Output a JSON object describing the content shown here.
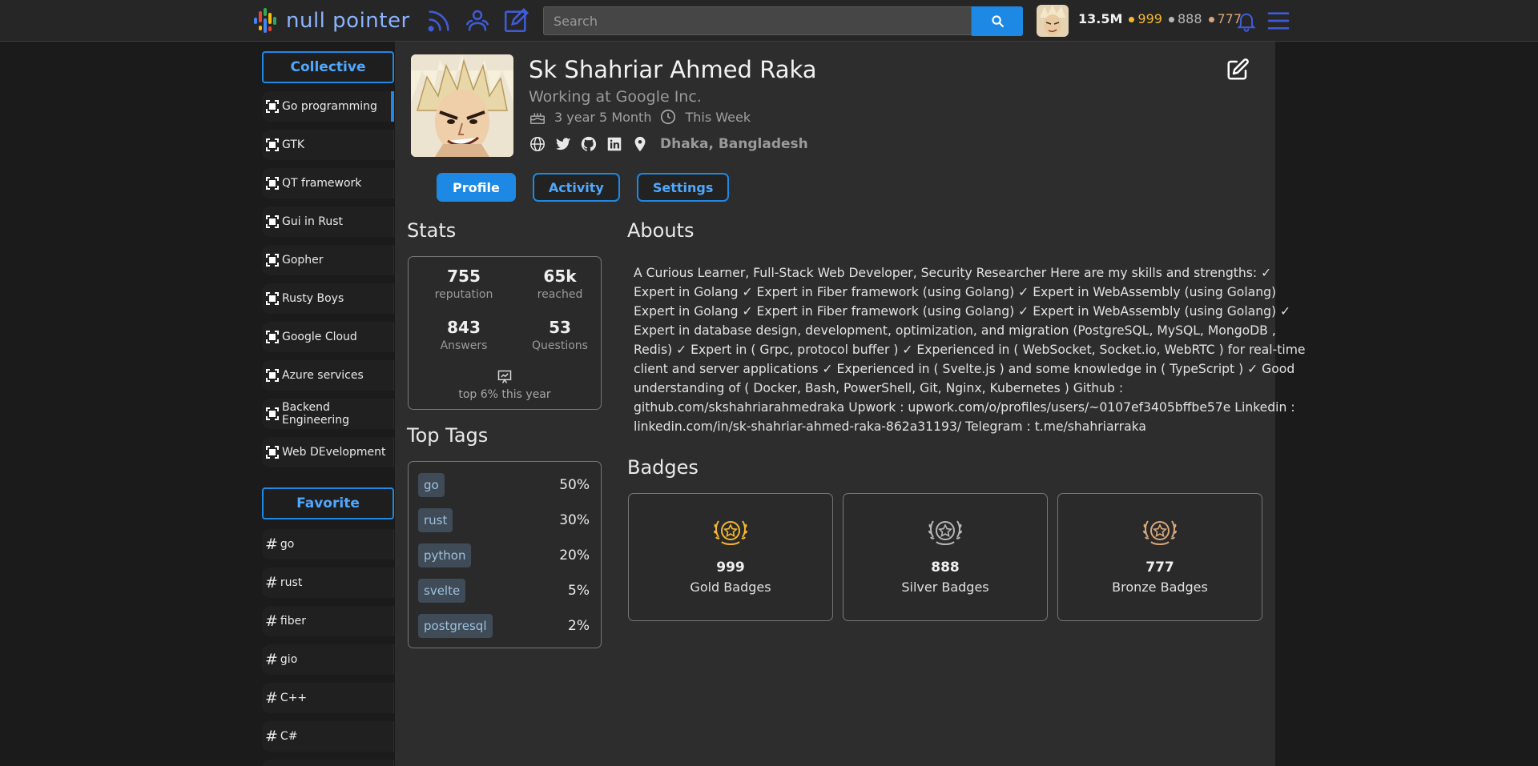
{
  "header": {
    "logo_text": "null pointer",
    "search_placeholder": "Search",
    "reputation": "13.5M",
    "gold": "999",
    "silver": "888",
    "bronze": "777"
  },
  "sidebar": {
    "collective_label": "Collective",
    "collectives": [
      "Go programming",
      "GTK",
      "QT framework",
      "Gui in Rust",
      "Gopher",
      "Rusty Boys",
      "Google Cloud",
      "Azure services",
      "Backend Engineering",
      "Web DEvelopment"
    ],
    "favorite_label": "Favorite",
    "favorites": [
      "go",
      "rust",
      "fiber",
      "gio",
      "C++",
      "C#"
    ]
  },
  "profile": {
    "name": "Sk Shahriar Ahmed Raka",
    "work": "Working at Google Inc.",
    "member_for": "3 year 5 Month",
    "last_seen": "This Week",
    "location": "Dhaka, Bangladesh"
  },
  "tabs": [
    "Profile",
    "Activity",
    "Settings"
  ],
  "stats": {
    "heading": "Stats",
    "reputation": "755",
    "reputation_label": "reputation",
    "reached": "65k",
    "reached_label": "reached",
    "answers": "843",
    "answers_label": "Answers",
    "questions": "53",
    "questions_label": "Questions",
    "top_text": "top 6% this year"
  },
  "top_tags": {
    "heading": "Top Tags",
    "items": [
      {
        "name": "go",
        "pct": "50%"
      },
      {
        "name": "rust",
        "pct": "30%"
      },
      {
        "name": "python",
        "pct": "20%"
      },
      {
        "name": "svelte",
        "pct": "5%"
      },
      {
        "name": "postgresql",
        "pct": "2%"
      }
    ]
  },
  "about": {
    "heading": "Abouts",
    "lines": [
      "A Curious Learner, Full-Stack Web Developer, Security Researcher Here are my skills and strengths: ✓",
      "Expert in Golang ✓ Expert in Fiber framework (using Golang) ✓ Expert in WebAssembly (using Golang)",
      "Expert in Golang ✓ Expert in Fiber framework (using Golang) ✓ Expert in WebAssembly (using Golang) ✓",
      "Expert in database design, development, optimization, and migration (PostgreSQL, MySQL, MongoDB ,",
      "Redis) ✓ Expert in ( Grpc, protocol buffer ) ✓ Experienced in ( WebSocket, Socket.io, WebRTC ) for real-time",
      "client and server applications ✓ Experienced in ( Svelte.js ) and some knowledge in ( TypeScript ) ✓ Good",
      "understanding of ( Docker, Bash, PowerShell, Git, Nginx, Kubernetes ) Github :",
      "github.com/skshahriarahmedraka Upwork : upwork.com/o/profiles/users/~0107ef3405bffbe57e Linkedin :",
      "linkedin.com/in/sk-shahriar-ahmed-raka-862a31193/ Telegram : t.me/shahriarraka"
    ]
  },
  "badges": {
    "heading": "Badges",
    "gold_count": "999",
    "gold_label": "Gold Badges",
    "gold_color": "#f5b82e",
    "silver_count": "888",
    "silver_label": "Silver Badges",
    "silver_color": "#b8b8b8",
    "bronze_count": "777",
    "bronze_label": "Bronze Badges",
    "bronze_color": "#d9a77b"
  },
  "colors": {
    "accent": "#1e88e5",
    "panel": "#2d2d2d",
    "background": "#1b1b1b"
  },
  "icons": [
    "logo-icon",
    "feed-icon",
    "users-icon",
    "edit-square-icon",
    "search-icon",
    "bell-icon",
    "menu-icon",
    "cake-icon",
    "clock-icon",
    "globe-icon",
    "twitter-icon",
    "github-icon",
    "linkedin-icon",
    "location-icon",
    "edit-icon",
    "collective-icon",
    "hash-icon",
    "presentation-icon",
    "wreath-icon"
  ]
}
